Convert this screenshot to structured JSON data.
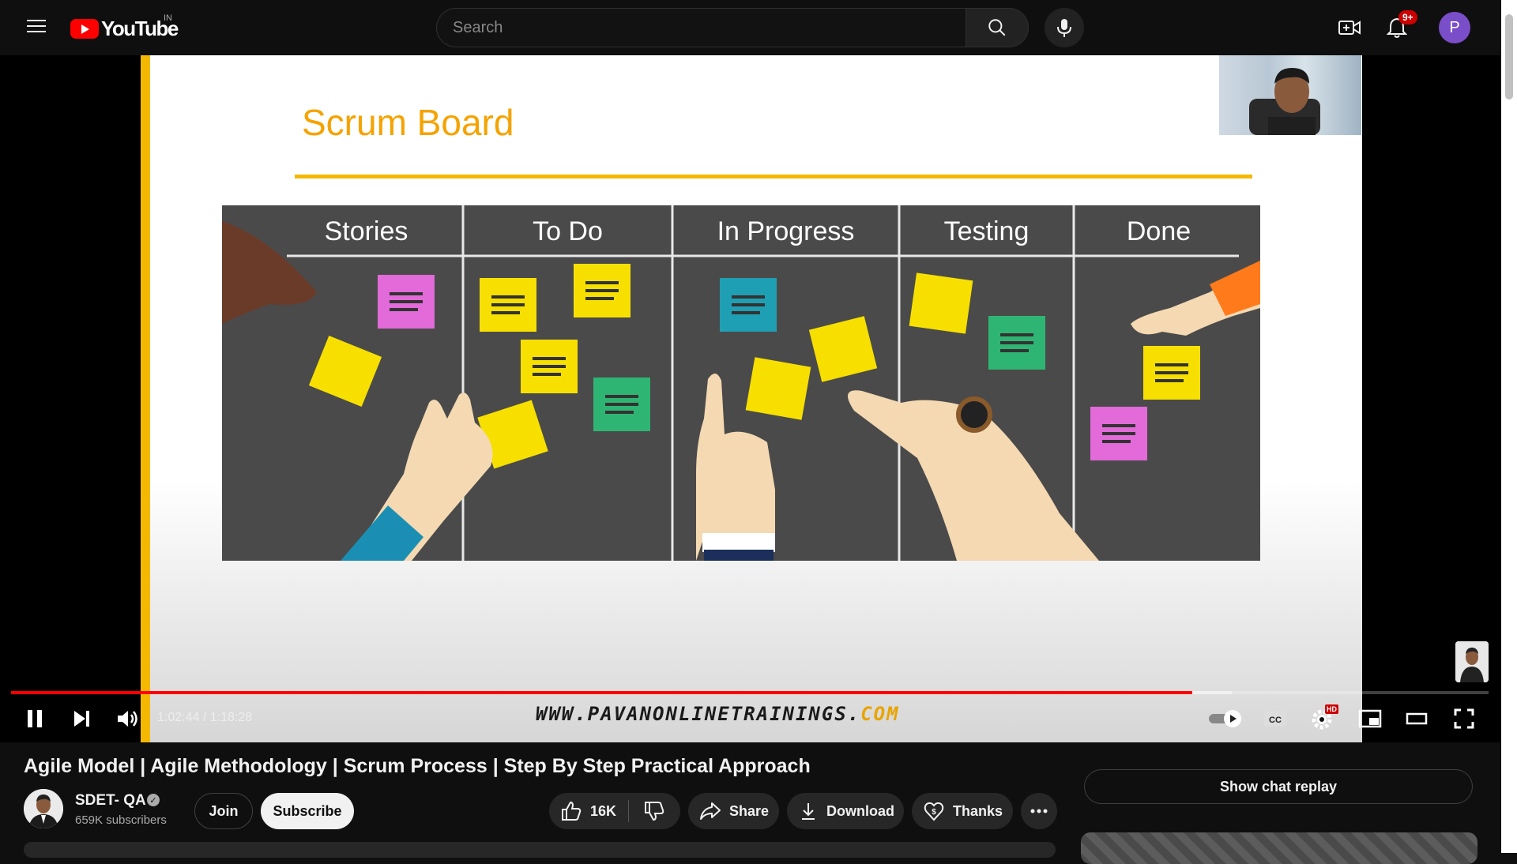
{
  "masthead": {
    "logo_text": "YouTube",
    "region": "IN",
    "search_placeholder": "Search",
    "notifications_count": "9+",
    "avatar_letter": "P"
  },
  "video": {
    "slide_title": "Scrum Board",
    "board_columns": [
      "Stories",
      "To Do",
      "In Progress",
      "Testing",
      "Done"
    ],
    "watermark_main": "WWW.PAVANONLINETRAININGS.",
    "watermark_suffix": "COM",
    "current_time": "1:02:44",
    "duration": "1:18:28",
    "time_display": "1:02:44 / 1:18:28",
    "progress_played_fraction": 0.7995,
    "progress_buffered_fraction": 0.826,
    "settings_badge": "HD"
  },
  "info": {
    "title": "Agile Model | Agile Methodology | Scrum Process | Step By Step Practical Approach",
    "channel_name": "SDET- QA",
    "subscribers": "659K subscribers",
    "join_label": "Join",
    "subscribe_label": "Subscribe",
    "like_count": "16K",
    "share_label": "Share",
    "download_label": "Download",
    "thanks_label": "Thanks",
    "chat_replay_label": "Show chat replay"
  },
  "colors": {
    "accent": "#ff0000",
    "slide_accent": "#f5b800",
    "background": "#0f0f0f"
  }
}
